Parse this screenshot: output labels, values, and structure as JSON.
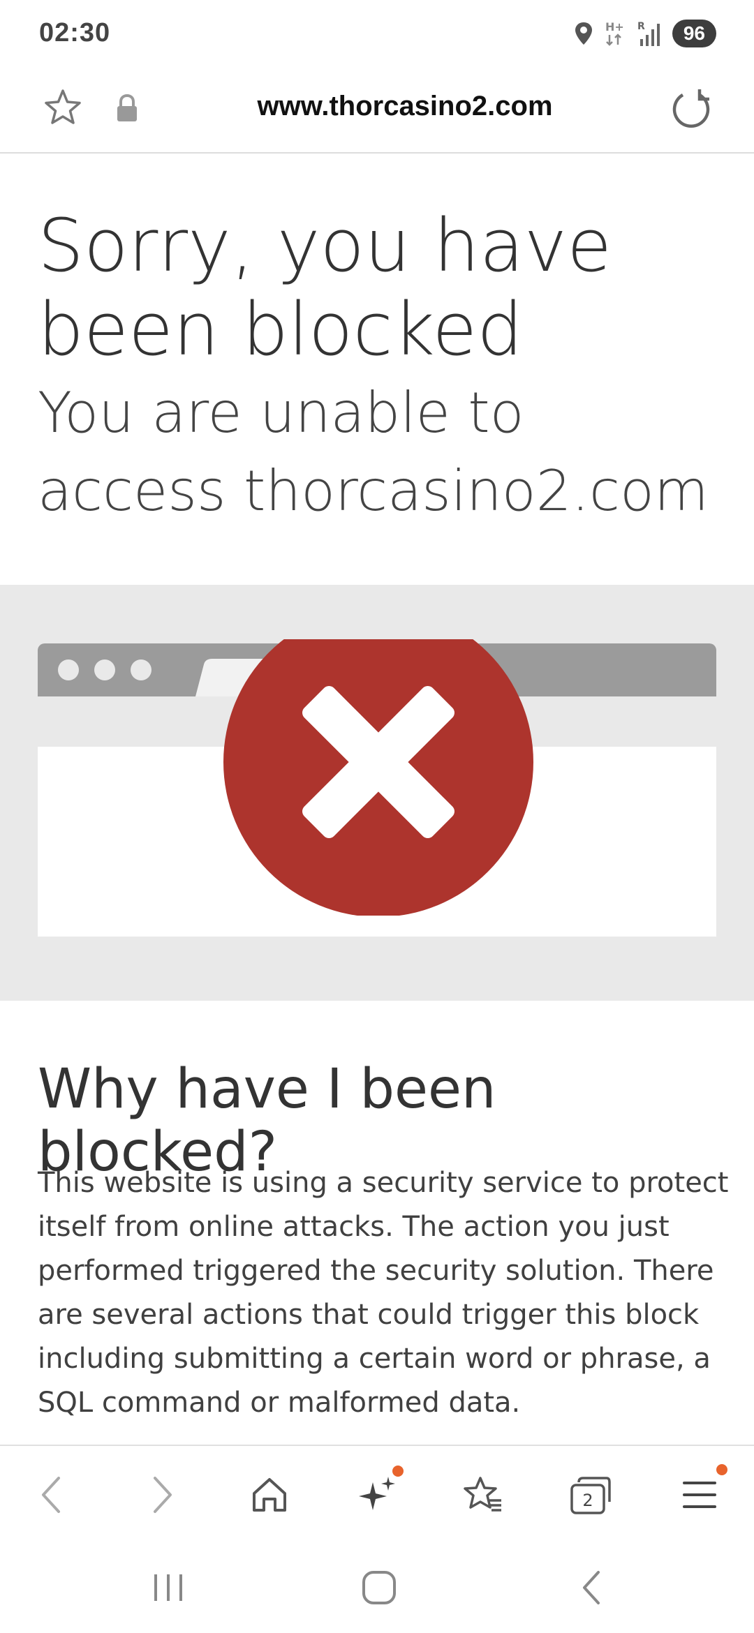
{
  "status_bar": {
    "time": "02:30",
    "battery": "96",
    "network_label": "H+",
    "signal_label": "R"
  },
  "address_bar": {
    "url": "www.thorcasino2.com"
  },
  "page": {
    "title": "Sorry, you have been blocked",
    "subtitle": "You are unable to access thorcasino2.com",
    "section_heading": "Why have I been blocked?",
    "section_body": "This website is using a security service to protect itself from online attacks. The action you just performed triggered the security solution. There are several actions that could trigger this block including submitting a certain word or phrase, a SQL command or malformed data."
  },
  "toolbar": {
    "tab_count": "2",
    "icons": [
      "back-icon",
      "forward-icon",
      "home-icon",
      "ai-sparkle-icon",
      "bookmarks-icon",
      "tabs-icon",
      "menu-icon"
    ]
  },
  "colors": {
    "error_red": "#ad342d",
    "notification_dot": "#e8632c",
    "band_gray": "#e9e9e9",
    "frame_gray": "#9b9b9b"
  }
}
